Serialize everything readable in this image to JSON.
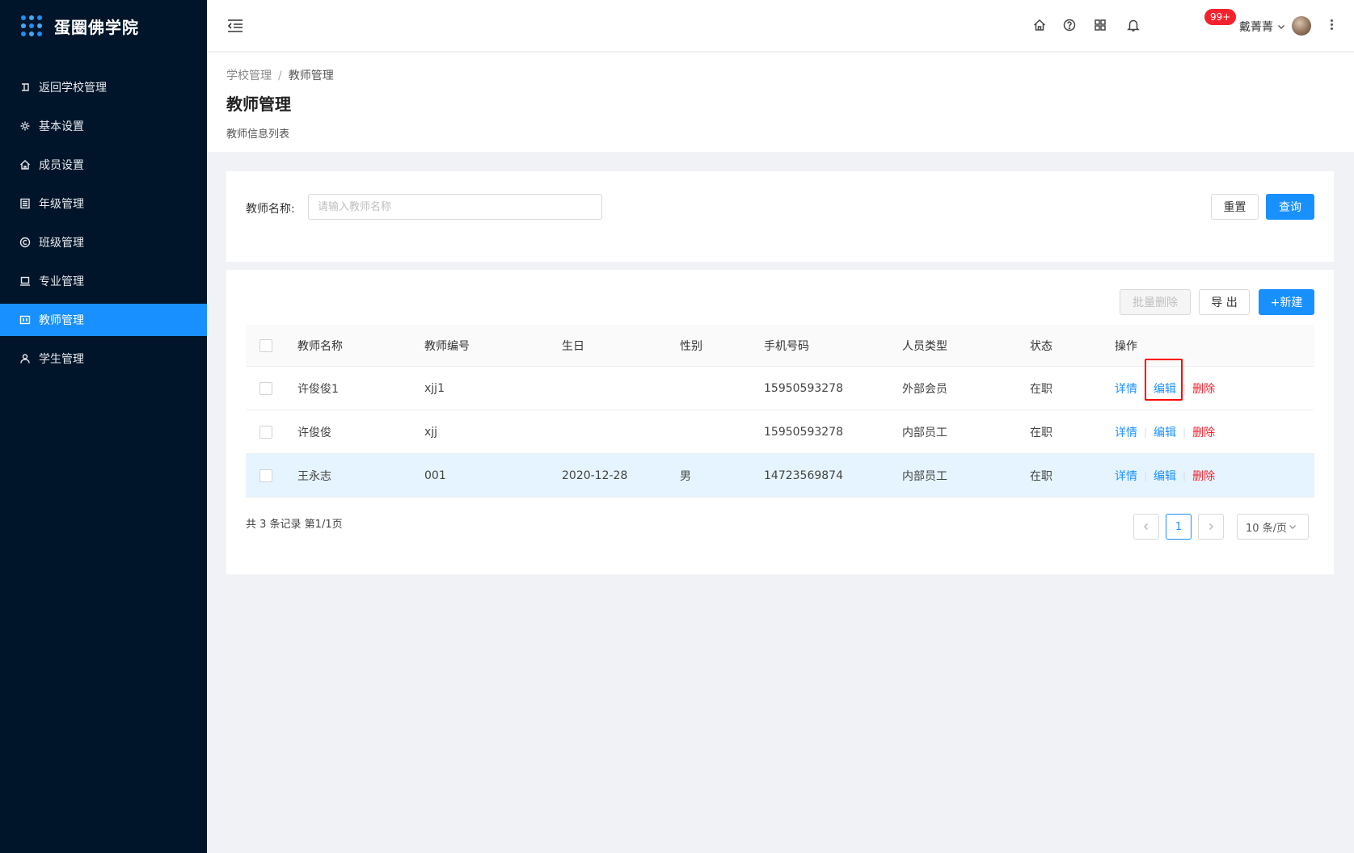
{
  "app": {
    "title": "蛋圈佛学院"
  },
  "sidebar": {
    "items": [
      {
        "label": "返回学校管理",
        "icon": "return-icon",
        "active": false
      },
      {
        "label": "基本设置",
        "icon": "gear-icon",
        "active": false
      },
      {
        "label": "成员设置",
        "icon": "home-icon",
        "active": false
      },
      {
        "label": "年级管理",
        "icon": "list-icon",
        "active": false
      },
      {
        "label": "班级管理",
        "icon": "copyright-icon",
        "active": false
      },
      {
        "label": "专业管理",
        "icon": "laptop-icon",
        "active": false
      },
      {
        "label": "教师管理",
        "icon": "id-card-icon",
        "active": true
      },
      {
        "label": "学生管理",
        "icon": "user-icon",
        "active": false
      }
    ]
  },
  "header": {
    "notification_badge": "99+",
    "user_name": "戴菁菁"
  },
  "breadcrumb": {
    "parent": "学校管理",
    "separator": "/",
    "current": "教师管理"
  },
  "page": {
    "title": "教师管理",
    "description": "教师信息列表"
  },
  "search": {
    "label": "教师名称:",
    "placeholder": "请输入教师名称",
    "value": "",
    "reset_label": "重置",
    "query_label": "查询"
  },
  "toolbar": {
    "batch_delete_label": "批量删除",
    "export_label": "导 出",
    "new_label": "+新建"
  },
  "table": {
    "columns": [
      "教师名称",
      "教师编号",
      "生日",
      "性别",
      "手机号码",
      "人员类型",
      "状态",
      "操作"
    ],
    "actions": {
      "detail": "详情",
      "edit": "编辑",
      "delete": "删除",
      "separator": "|"
    },
    "rows": [
      {
        "name": "许俊俊1",
        "code": "xjj1",
        "birthday": "",
        "gender": "",
        "phone": "15950593278",
        "type": "外部会员",
        "status": "在职"
      },
      {
        "name": "许俊俊",
        "code": "xjj",
        "birthday": "",
        "gender": "",
        "phone": "15950593278",
        "type": "内部员工",
        "status": "在职"
      },
      {
        "name": "王永志",
        "code": "001",
        "birthday": "2020-12-28",
        "gender": "男",
        "phone": "14723569874",
        "type": "内部员工",
        "status": "在职"
      }
    ]
  },
  "pagination": {
    "summary": "共 3 条记录 第1/1页",
    "current_page": "1",
    "page_size_label": "10 条/页"
  },
  "colors": {
    "primary": "#1890ff",
    "danger": "#f5222d",
    "sidebar_bg": "#001529"
  }
}
